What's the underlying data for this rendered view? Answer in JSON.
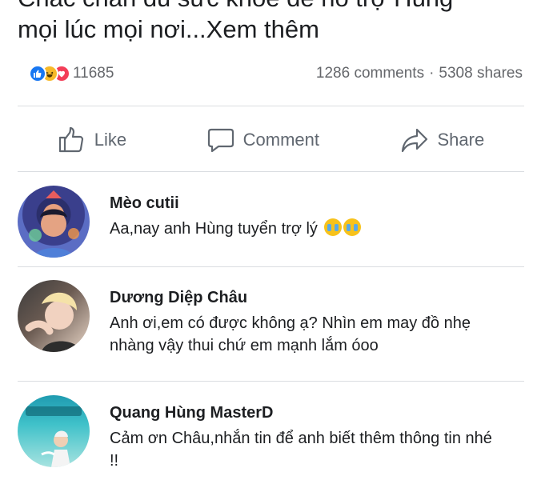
{
  "post": {
    "line1": "Chắc chắn đủ sức khỏe để hỗ trợ Hùng",
    "line2": "mọi lúc mọi nơi...",
    "see_more": "Xem thêm"
  },
  "summary": {
    "reaction_icons": [
      "like-icon",
      "haha-icon",
      "love-icon"
    ],
    "reaction_count": "11685",
    "comments": "1286 comments",
    "separator": "·",
    "shares": "5308 shares"
  },
  "actions": {
    "like": "Like",
    "comment": "Comment",
    "share": "Share"
  },
  "comments": [
    {
      "author": "Mèo cutii",
      "text": "Aa,nay anh Hùng tuyển trợ lý"
    },
    {
      "author": "Dương Diệp Châu",
      "text": "Anh ơi,em có được không ạ? Nhìn em may đồ nhẹ nhàng vậy thui chứ em mạnh lắm óoo"
    },
    {
      "author": "Quang Hùng MasterD",
      "text": "Cảm ơn Châu,nhắn tin để anh biết thêm thông tin nhé !!"
    }
  ],
  "colors": {
    "like_blue": "#1877f2",
    "haha_yellow": "#f7b928",
    "love_red": "#f33e58",
    "secondary_text": "#65676b",
    "divider": "#dadde1"
  }
}
